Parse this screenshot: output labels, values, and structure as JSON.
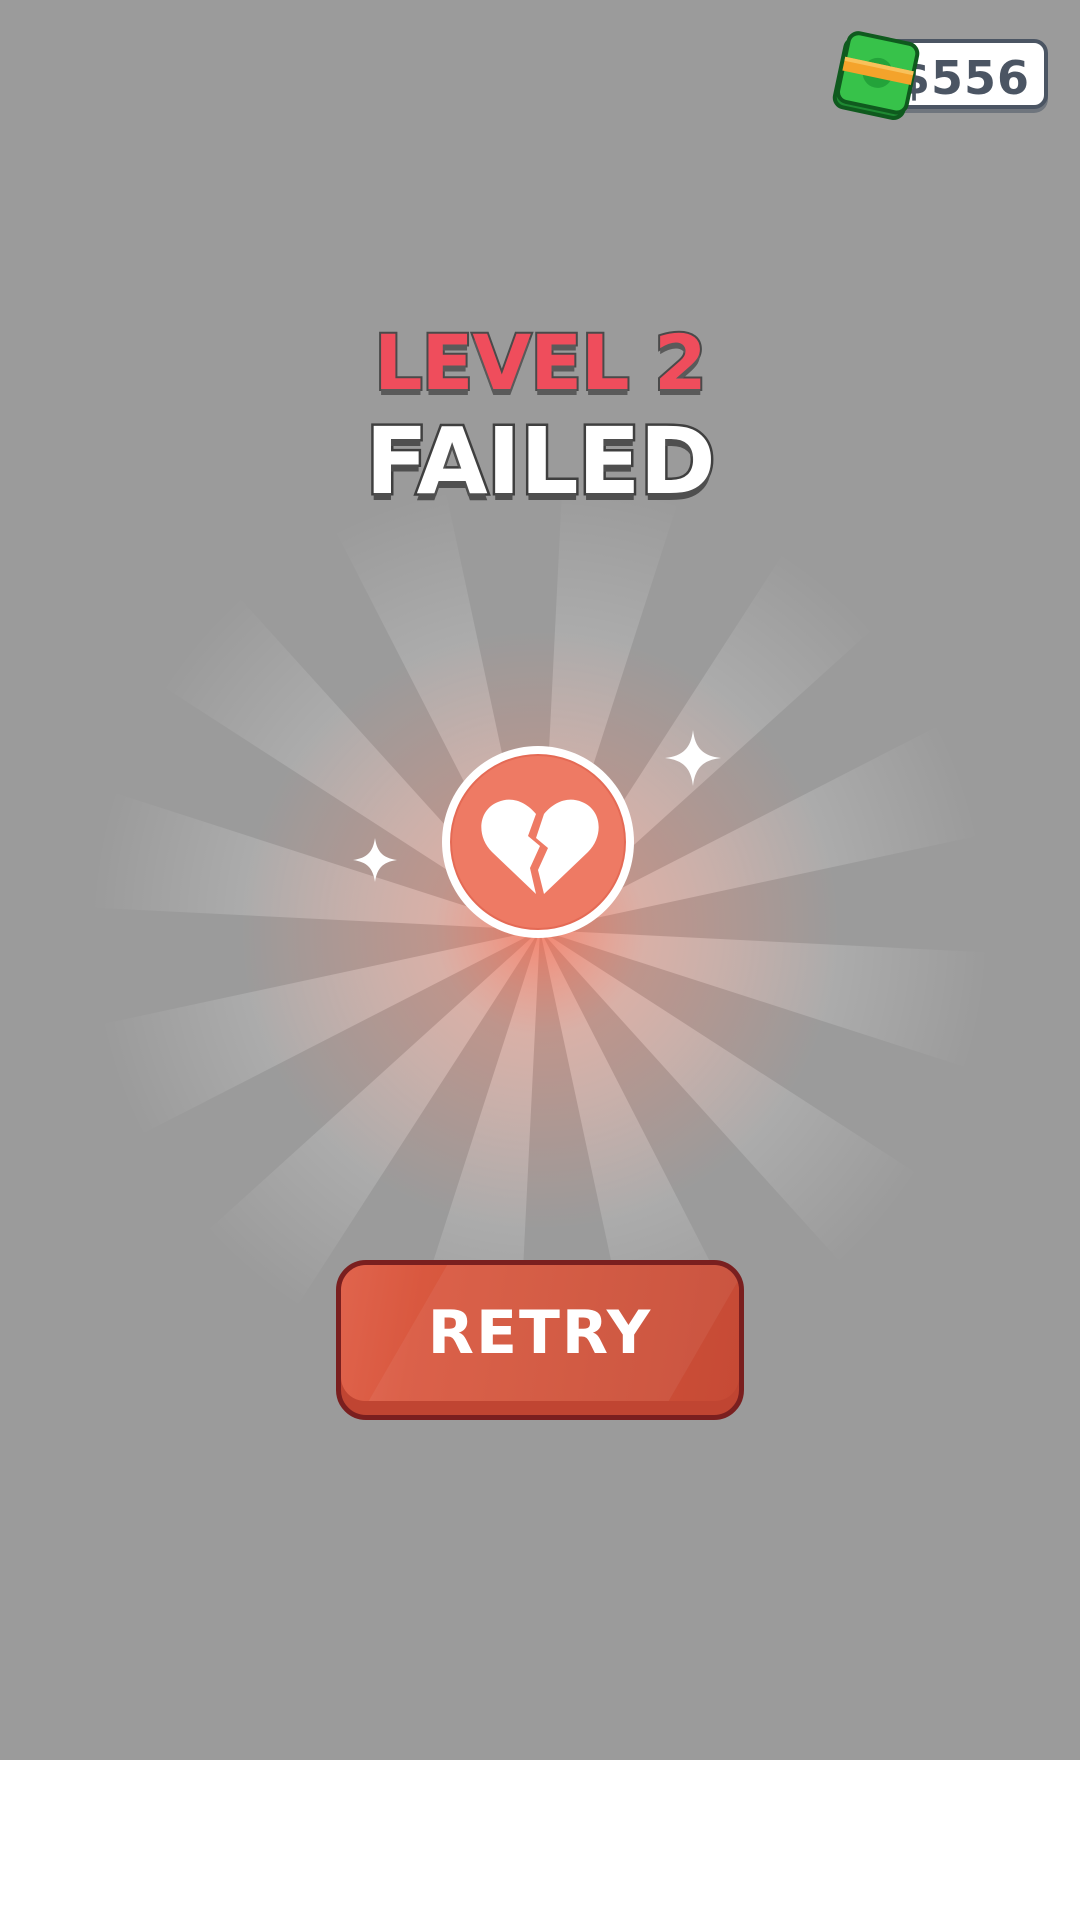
{
  "currency": {
    "amount": "$556",
    "icon": "cash-stack-icon"
  },
  "title": {
    "level": "LEVEL 2",
    "status": "FAILED"
  },
  "result": {
    "icon": "broken-heart-icon",
    "sparkle_icons": [
      "sparkle-icon",
      "sparkle-icon"
    ]
  },
  "actions": {
    "retry_label": "RETRY"
  },
  "colors": {
    "background": "#9b9b9b",
    "level_text": "#ef4d5c",
    "badge": "#ef7a66",
    "retry_button": "#d05139"
  }
}
